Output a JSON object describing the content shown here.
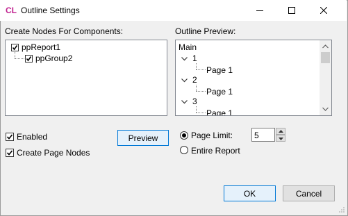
{
  "window": {
    "logo": "CL",
    "title": "Outline Settings"
  },
  "components": {
    "label": "Create Nodes For Components:",
    "items": [
      {
        "label": "ppReport1",
        "checked": true
      },
      {
        "label": "ppGroup2",
        "checked": true
      }
    ]
  },
  "preview": {
    "label": "Outline Preview:",
    "root": "Main",
    "nodes": [
      {
        "label": "1",
        "child": "Page 1"
      },
      {
        "label": "2",
        "child": "Page 1"
      },
      {
        "label": "3",
        "child": "Page 1"
      }
    ]
  },
  "options": {
    "enabled_label": "Enabled",
    "enabled_checked": true,
    "create_pages_label": "Create Page Nodes",
    "create_pages_checked": true,
    "preview_button": "Preview"
  },
  "limit": {
    "page_limit_label": "Page Limit:",
    "page_limit_value": "5",
    "entire_report_label": "Entire Report",
    "selected": "page_limit"
  },
  "footer": {
    "ok": "OK",
    "cancel": "Cancel"
  },
  "colors": {
    "accent": "#0078d7",
    "logo": "#c0208f"
  }
}
